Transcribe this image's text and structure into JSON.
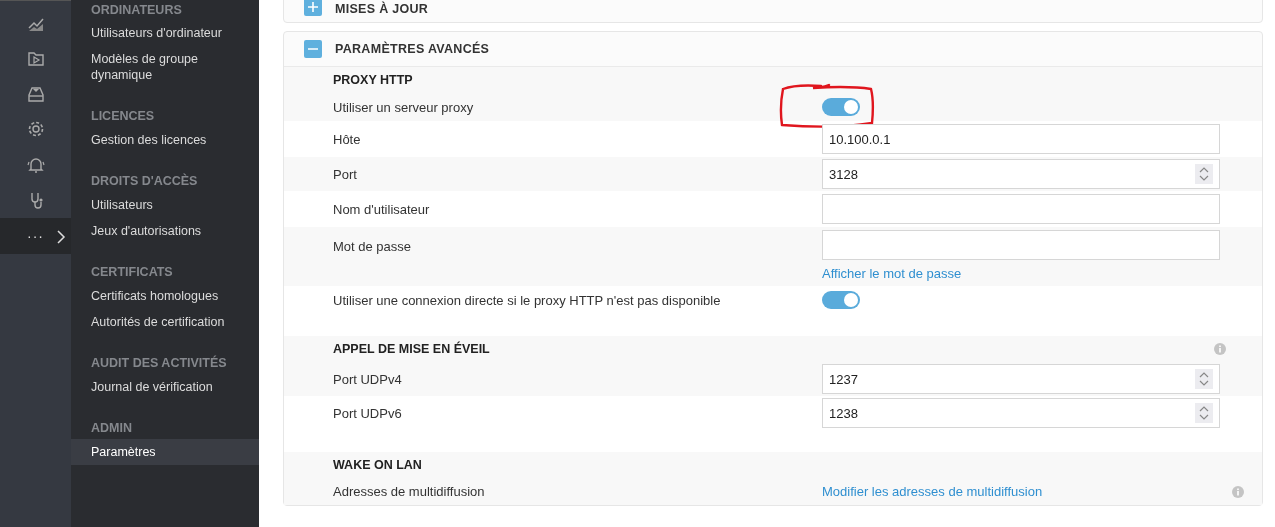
{
  "rail": {
    "items": [
      {
        "selected": false
      },
      {
        "selected": false
      },
      {
        "selected": false
      },
      {
        "selected": false
      },
      {
        "selected": false
      },
      {
        "selected": false
      },
      {
        "label": "···",
        "selected": true
      }
    ]
  },
  "nav": {
    "sections": [
      {
        "heading": "ORDINATEURS",
        "items": [
          {
            "label": "Utilisateurs d'ordinateur",
            "selected": false
          },
          {
            "label": "Modèles de groupe dynamique",
            "selected": false
          }
        ]
      },
      {
        "heading": "LICENCES",
        "items": [
          {
            "label": "Gestion des licences",
            "selected": false
          }
        ]
      },
      {
        "heading": "DROITS D'ACCÈS",
        "items": [
          {
            "label": "Utilisateurs",
            "selected": false
          },
          {
            "label": "Jeux d'autorisations",
            "selected": false
          }
        ]
      },
      {
        "heading": "CERTIFICATS",
        "items": [
          {
            "label": "Certificats homologues",
            "selected": false
          },
          {
            "label": "Autorités de certification",
            "selected": false
          }
        ]
      },
      {
        "heading": "AUDIT DES ACTIVITÉS",
        "items": [
          {
            "label": "Journal de vérification",
            "selected": false
          }
        ]
      },
      {
        "heading": "ADMIN",
        "items": [
          {
            "label": "Paramètres",
            "selected": true
          }
        ]
      }
    ]
  },
  "panels": [
    {
      "title": "MISES À JOUR",
      "expanded": false
    },
    {
      "title": "PARAMÈTRES AVANCÉS",
      "expanded": true,
      "sections": [
        {
          "title": "PROXY HTTP",
          "info": false,
          "rows": [
            {
              "kind": "toggle",
              "label": "Utiliser un serveur proxy",
              "on": true,
              "highlighted": true
            },
            {
              "kind": "text",
              "label": "Hôte",
              "value": "10.100.0.1"
            },
            {
              "kind": "number",
              "label": "Port",
              "value": "3128"
            },
            {
              "kind": "text",
              "label": "Nom d'utilisateur"
            },
            {
              "kind": "text",
              "label": "Mot de passe",
              "link": "Afficher le mot de passe"
            },
            {
              "kind": "toggle",
              "label": "Utiliser une connexion directe si le proxy HTTP n'est pas disponible",
              "on": true,
              "highlighted": false
            }
          ]
        },
        {
          "title": "APPEL DE MISE EN ÉVEIL",
          "info": true,
          "rows": [
            {
              "kind": "number",
              "label": "Port UDPv4",
              "value": "1237"
            },
            {
              "kind": "number",
              "label": "Port UDPv6",
              "value": "1238"
            }
          ]
        },
        {
          "title": "WAKE ON LAN",
          "info": false,
          "rows": [
            {
              "kind": "link",
              "label": "Adresses de multidiffusion",
              "link": "Modifier les adresses de multidiffusion",
              "info": true
            }
          ]
        }
      ]
    }
  ]
}
